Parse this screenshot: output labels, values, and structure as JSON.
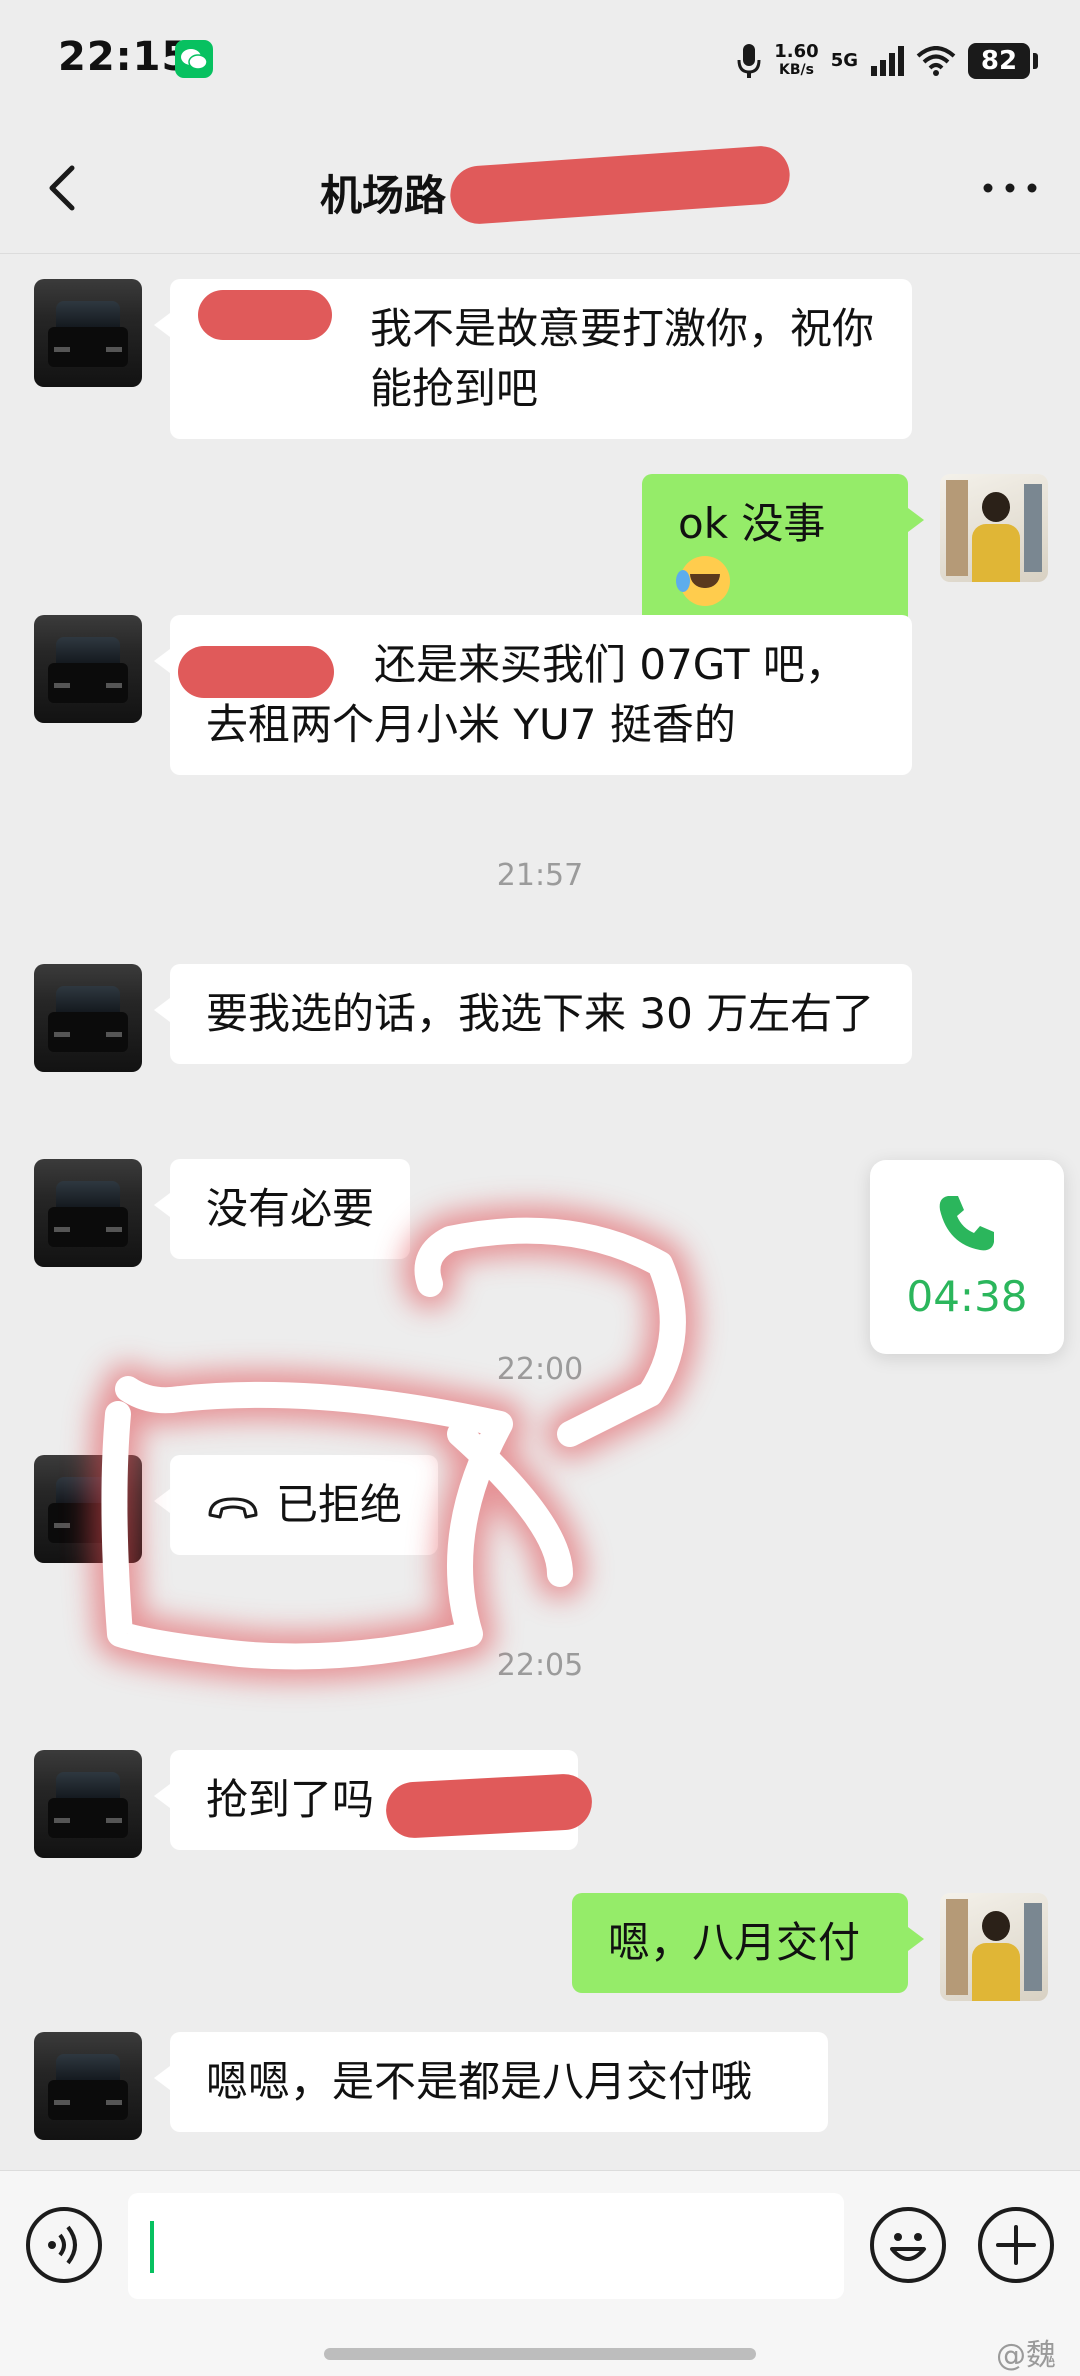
{
  "status_bar": {
    "time": "22:15",
    "net_speed_value": "1.60",
    "net_speed_unit": "KB/s",
    "network": "5G",
    "battery": "82",
    "icons": [
      "wechat-icon",
      "microphone-icon",
      "signal-icon",
      "wifi-icon",
      "battery-icon"
    ]
  },
  "nav": {
    "title": "机场路",
    "back_icon": "chevron-left-icon",
    "more_icon": "more-dots-icon"
  },
  "messages": [
    {
      "side": "in",
      "text": "我不是故意要打激你，祝你能抢到吧"
    },
    {
      "side": "out",
      "text": "ok 没事",
      "emoji": "crying-laughing-emoji"
    },
    {
      "side": "in",
      "text": "还是来买我们 07GT 吧，去租两个月小米 YU7 挺香的"
    },
    {
      "side": "time",
      "text": "21:57"
    },
    {
      "side": "in",
      "text": "要我选的话，我选下来 30 万左右了"
    },
    {
      "side": "in",
      "text": "没有必要"
    },
    {
      "side": "time",
      "text": "22:00"
    },
    {
      "side": "in",
      "text": "已拒绝",
      "icon": "call-rejected-icon"
    },
    {
      "side": "time",
      "text": "22:05"
    },
    {
      "side": "in",
      "text": "抢到了吗"
    },
    {
      "side": "out",
      "text": "嗯，八月交付"
    },
    {
      "side": "in",
      "text": "嗯嗯，是不是都是八月交付哦"
    }
  ],
  "call_float": {
    "duration": "04:38",
    "icon": "phone-icon"
  },
  "input_bar": {
    "voice_icon": "voice-icon",
    "emoji_icon": "emoji-icon",
    "plus_icon": "plus-icon"
  },
  "watermark": "@魏",
  "colors": {
    "background": "#ededed",
    "incoming_bubble": "#ffffff",
    "outgoing_bubble": "#95ec69",
    "accent_green": "#07c160",
    "redaction": "#e05a5a"
  }
}
